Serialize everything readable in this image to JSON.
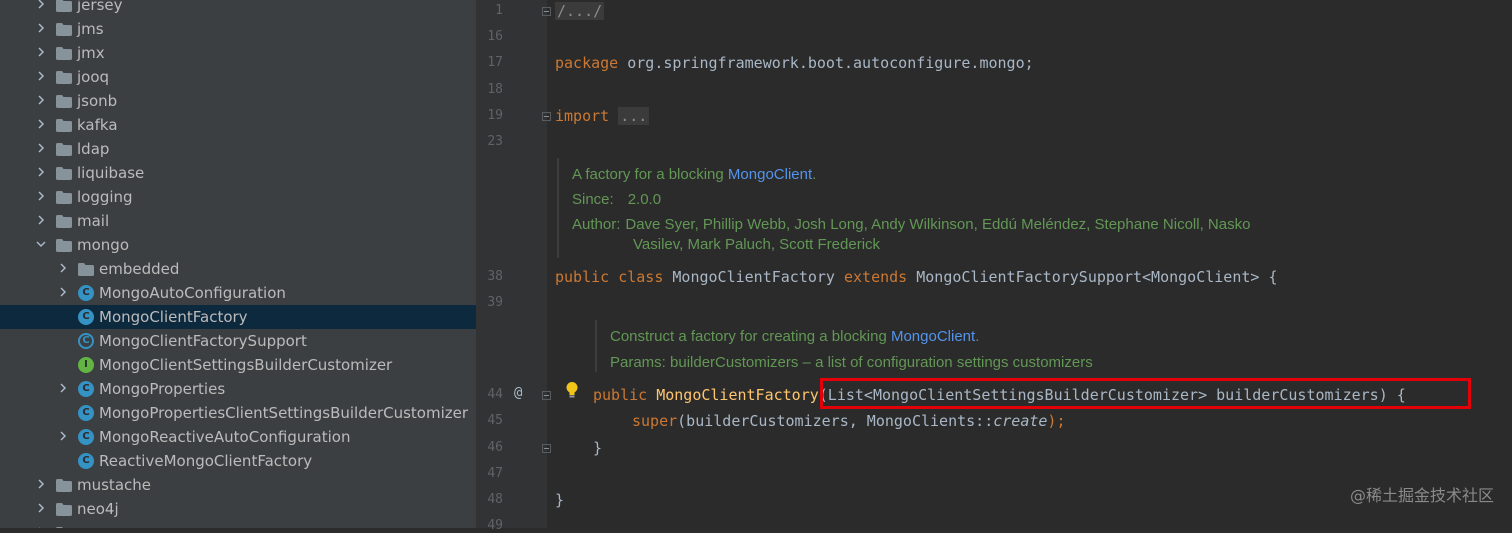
{
  "project_tree": {
    "items": [
      {
        "label": "jersey",
        "kind": "folder"
      },
      {
        "label": "jms",
        "kind": "folder"
      },
      {
        "label": "jmx",
        "kind": "folder"
      },
      {
        "label": "jooq",
        "kind": "folder"
      },
      {
        "label": "jsonb",
        "kind": "folder"
      },
      {
        "label": "kafka",
        "kind": "folder"
      },
      {
        "label": "ldap",
        "kind": "folder"
      },
      {
        "label": "liquibase",
        "kind": "folder"
      },
      {
        "label": "logging",
        "kind": "folder"
      },
      {
        "label": "mail",
        "kind": "folder"
      },
      {
        "label": "mongo",
        "kind": "folder",
        "expanded": true
      },
      {
        "label": "embedded",
        "kind": "folder"
      },
      {
        "label": "MongoAutoConfiguration",
        "kind": "class",
        "icon": "C"
      },
      {
        "label": "MongoClientFactory",
        "kind": "class",
        "icon": "C",
        "selected": true
      },
      {
        "label": "MongoClientFactorySupport",
        "kind": "abstract-class",
        "icon": "C"
      },
      {
        "label": "MongoClientSettingsBuilderCustomizer",
        "kind": "interface",
        "icon": "I"
      },
      {
        "label": "MongoProperties",
        "kind": "class",
        "icon": "C"
      },
      {
        "label": "MongoPropertiesClientSettingsBuilderCustomizer",
        "kind": "class",
        "icon": "C"
      },
      {
        "label": "MongoReactiveAutoConfiguration",
        "kind": "class",
        "icon": "C"
      },
      {
        "label": "ReactiveMongoClientFactory",
        "kind": "class",
        "icon": "C"
      },
      {
        "label": "mustache",
        "kind": "folder"
      },
      {
        "label": "neo4j",
        "kind": "folder"
      },
      {
        "label": "n",
        "kind": "folder"
      }
    ]
  },
  "editor": {
    "line_numbers": [
      "1",
      "16",
      "17",
      "18",
      "19",
      "23",
      "38",
      "39",
      "44",
      "45",
      "46",
      "47",
      "48",
      "49"
    ],
    "gutter_at": "@",
    "line1": "/.../",
    "package_kw": "package",
    "package_name": " org.springframework.boot.autoconfigure.mongo;",
    "import_kw": "import",
    "import_collapsed": "...",
    "class_doc": {
      "text": "A factory for a blocking ",
      "link": "MongoClient",
      "end": ".",
      "since_label": "Since:",
      "since_value": "2.0.0",
      "author_label": "Author:",
      "author_line1": "Dave Syer, Phillip Webb, Josh Long, Andy Wilkinson, Eddú Meléndez, Stephane Nicoll, Nasko",
      "author_line2": "Vasilev, Mark Paluch, Scott Frederick"
    },
    "class_decl": {
      "kw1": "public class",
      "name": " MongoClientFactory ",
      "kw2": "extends",
      "rest": " MongoClientFactorySupport<MongoClient> {"
    },
    "ctor_doc": {
      "text": "Construct a factory for creating a blocking ",
      "link": "MongoClient",
      "end": ".",
      "params": "Params: builderCustomizers – a list of configuration settings customizers"
    },
    "ctor_decl": {
      "kw": "public",
      "name_pre": " MongoClientFactor",
      "name_last": "y",
      "params": "(List<MongoClientSettingsBuilderCustomizer> builderCustomizers) {"
    },
    "super_call": {
      "kw": "super",
      "args": "(builderCustomizers, MongoClients::",
      "method": "create",
      "end": ");"
    },
    "close_brace_inner": "}",
    "close_brace_outer": "}"
  },
  "watermark": "@稀土掘金技术社区"
}
